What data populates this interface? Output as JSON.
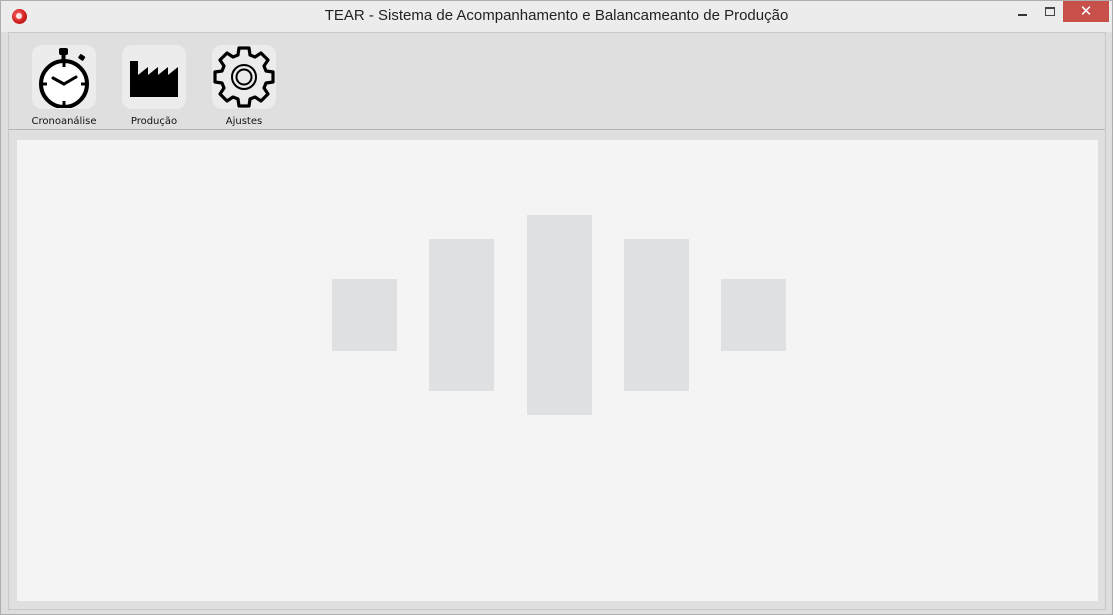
{
  "window": {
    "title": "TEAR - Sistema de Acompanhamento e Balancameanto de Produção",
    "controls": {
      "minimize": "minimize",
      "maximize": "maximize",
      "close": "✕"
    }
  },
  "toolbar": {
    "items": [
      {
        "label": "Cronoanálise",
        "icon": "stopwatch-icon"
      },
      {
        "label": "Produção",
        "icon": "factory-icon"
      },
      {
        "label": "Ajustes",
        "icon": "gear-icon"
      }
    ]
  },
  "colors": {
    "close_button": "#c7504b",
    "app_icon": "#d11f1f",
    "workspace": "#f4f4f4",
    "placeholder_bars": "#dfe0e1"
  },
  "loading_placeholder": {
    "icon": "loading-bars-icon"
  }
}
